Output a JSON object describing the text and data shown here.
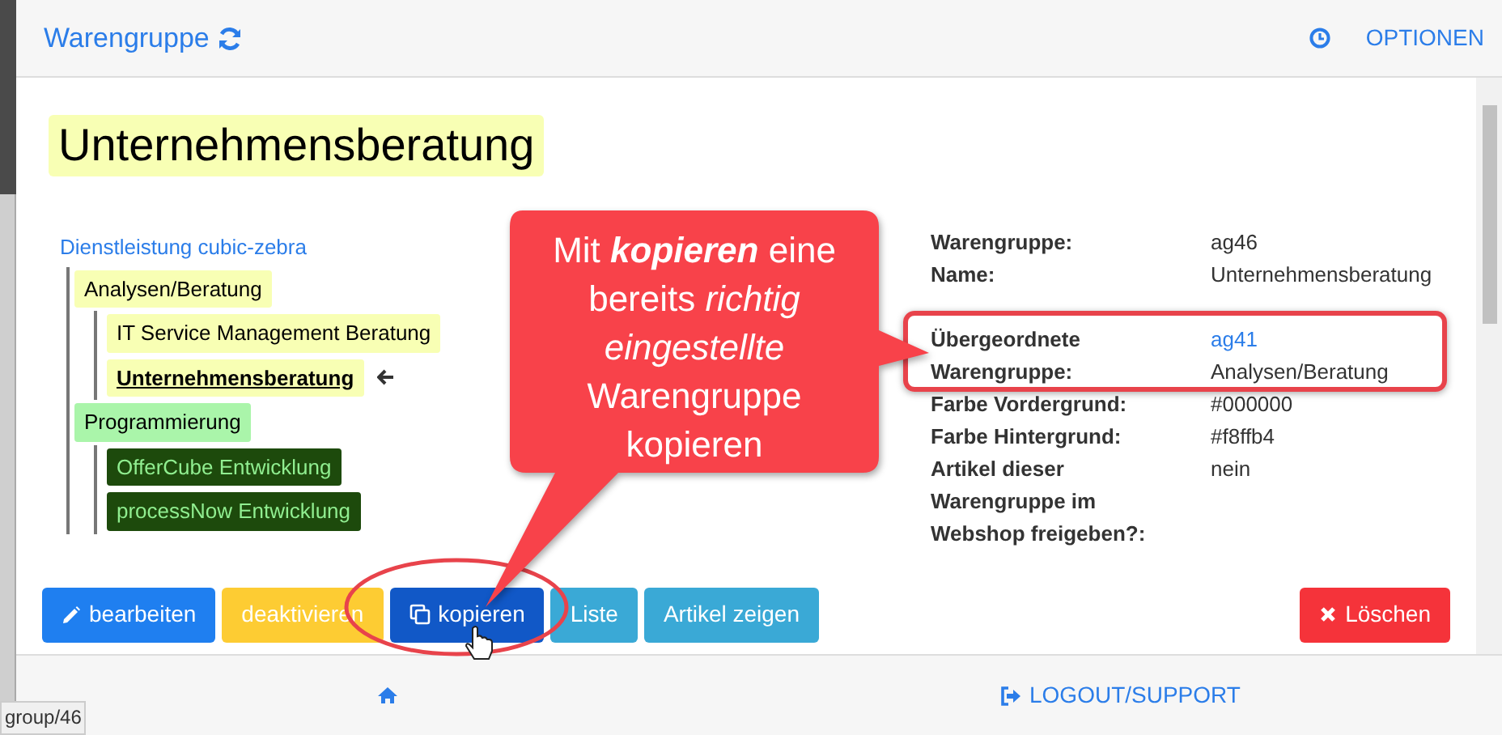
{
  "header": {
    "title": "Warengruppe",
    "options_label": "OPTIONEN"
  },
  "heading": "Unternehmensberatung",
  "tree": {
    "label": "Dienstleistung cubic-zebra",
    "children": [
      {
        "label": "Analysen/Beratung",
        "color": "#f8ffb4",
        "current": false,
        "children": [
          {
            "label": "IT Service Management Beratung",
            "color": "#f8ffb4",
            "current": false
          },
          {
            "label": "Unternehmensberatung",
            "color": "#f8ffb4",
            "current": true
          }
        ]
      },
      {
        "label": "Programmierung",
        "color": "#aaf5aa",
        "current": false,
        "children": [
          {
            "label": "OfferCube Entwicklung",
            "color": "#1d4a0c",
            "current": false
          },
          {
            "label": "processNow Entwicklung",
            "color": "#1d4a0c",
            "current": false
          }
        ]
      }
    ]
  },
  "details": [
    {
      "label": "Warengruppe:",
      "value": "ag46",
      "kind": "text"
    },
    {
      "label": "Name:",
      "value": "Unternehmensberatung",
      "kind": "text"
    },
    {
      "label": "Übergeordnete Warengruppe:",
      "value": "ag41",
      "value2": "Analysen/Beratung",
      "kind": "link"
    },
    {
      "label": "Farbe Vordergrund:",
      "value": "#000000",
      "kind": "text"
    },
    {
      "label": "Farbe Hintergrund:",
      "value": "#f8ffb4",
      "kind": "text"
    },
    {
      "label": "Artikel dieser Warengruppe im Webshop freigeben?:",
      "value": "nein",
      "kind": "text"
    }
  ],
  "buttons": [
    {
      "label": "bearbeiten",
      "kind": "primary"
    },
    {
      "label": "deaktivieren",
      "kind": "warning"
    },
    {
      "label": "kopieren",
      "kind": "active"
    },
    {
      "label": "Liste",
      "kind": "info"
    },
    {
      "label": "Artikel zeigen",
      "kind": "info"
    }
  ],
  "delete_button": {
    "label": "Löschen",
    "kind": "danger"
  },
  "footer": {
    "logout_label": "LOGOUT/SUPPORT"
  },
  "callout": {
    "text": "Mit **kopieren** eine bereits *richtig eingestellte* Warengruppe kopieren"
  },
  "status_url": "group/46"
}
